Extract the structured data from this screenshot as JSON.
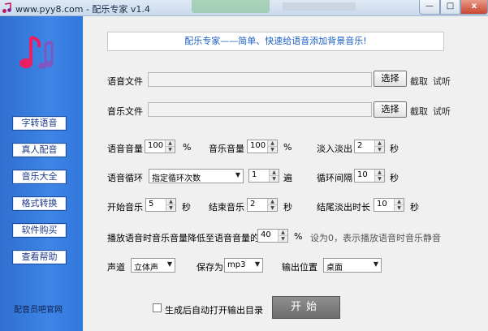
{
  "window": {
    "title": "www.pyy8.com - 配乐专家 v1.4",
    "min_label": "—",
    "max_label": "□",
    "close_label": "x"
  },
  "sidebar": {
    "items": [
      "字转语音",
      "真人配音",
      "音乐大全",
      "格式转换",
      "软件购买",
      "查看帮助"
    ],
    "footer": "配音员吧官网"
  },
  "banner": "配乐专家——简单、快速给语音添加背景音乐!",
  "voice_file": {
    "label": "语音文件",
    "button": "选择",
    "cut": "截取",
    "listen": "试听"
  },
  "music_file": {
    "label": "音乐文件",
    "button": "选择",
    "cut": "截取",
    "listen": "试听"
  },
  "row1": {
    "voice_volume": {
      "label": "语音音量",
      "value": "100",
      "unit": "%"
    },
    "music_volume": {
      "label": "音乐音量",
      "value": "100",
      "unit": "%"
    },
    "fade": {
      "label": "淡入淡出",
      "value": "2",
      "unit": "秒"
    }
  },
  "row2": {
    "voice_loop": {
      "label": "语音循环",
      "selected": "指定循环次数",
      "count": "1",
      "unit": "遍"
    },
    "loop_interval": {
      "label": "循环间隔",
      "value": "10",
      "unit": "秒"
    }
  },
  "row3": {
    "start_music": {
      "label": "开始音乐",
      "value": "5",
      "unit": "秒"
    },
    "end_music": {
      "label": "结束音乐",
      "value": "2",
      "unit": "秒"
    },
    "end_fade": {
      "label": "结尾淡出时长",
      "value": "10",
      "unit": "秒"
    }
  },
  "row4": {
    "label": "播放语音时音乐音量降低至语音音量的",
    "value": "40",
    "unit": "%",
    "hint": "设为0，表示播放语音时音乐静音"
  },
  "row5": {
    "channel": {
      "label": "声道",
      "selected": "立体声"
    },
    "save_as": {
      "label": "保存为",
      "selected": "mp3"
    },
    "output": {
      "label": "输出位置",
      "selected": "桌面"
    }
  },
  "auto_open": {
    "label": "生成后自动打开输出目录",
    "checked": false
  },
  "start_button": "开始"
}
